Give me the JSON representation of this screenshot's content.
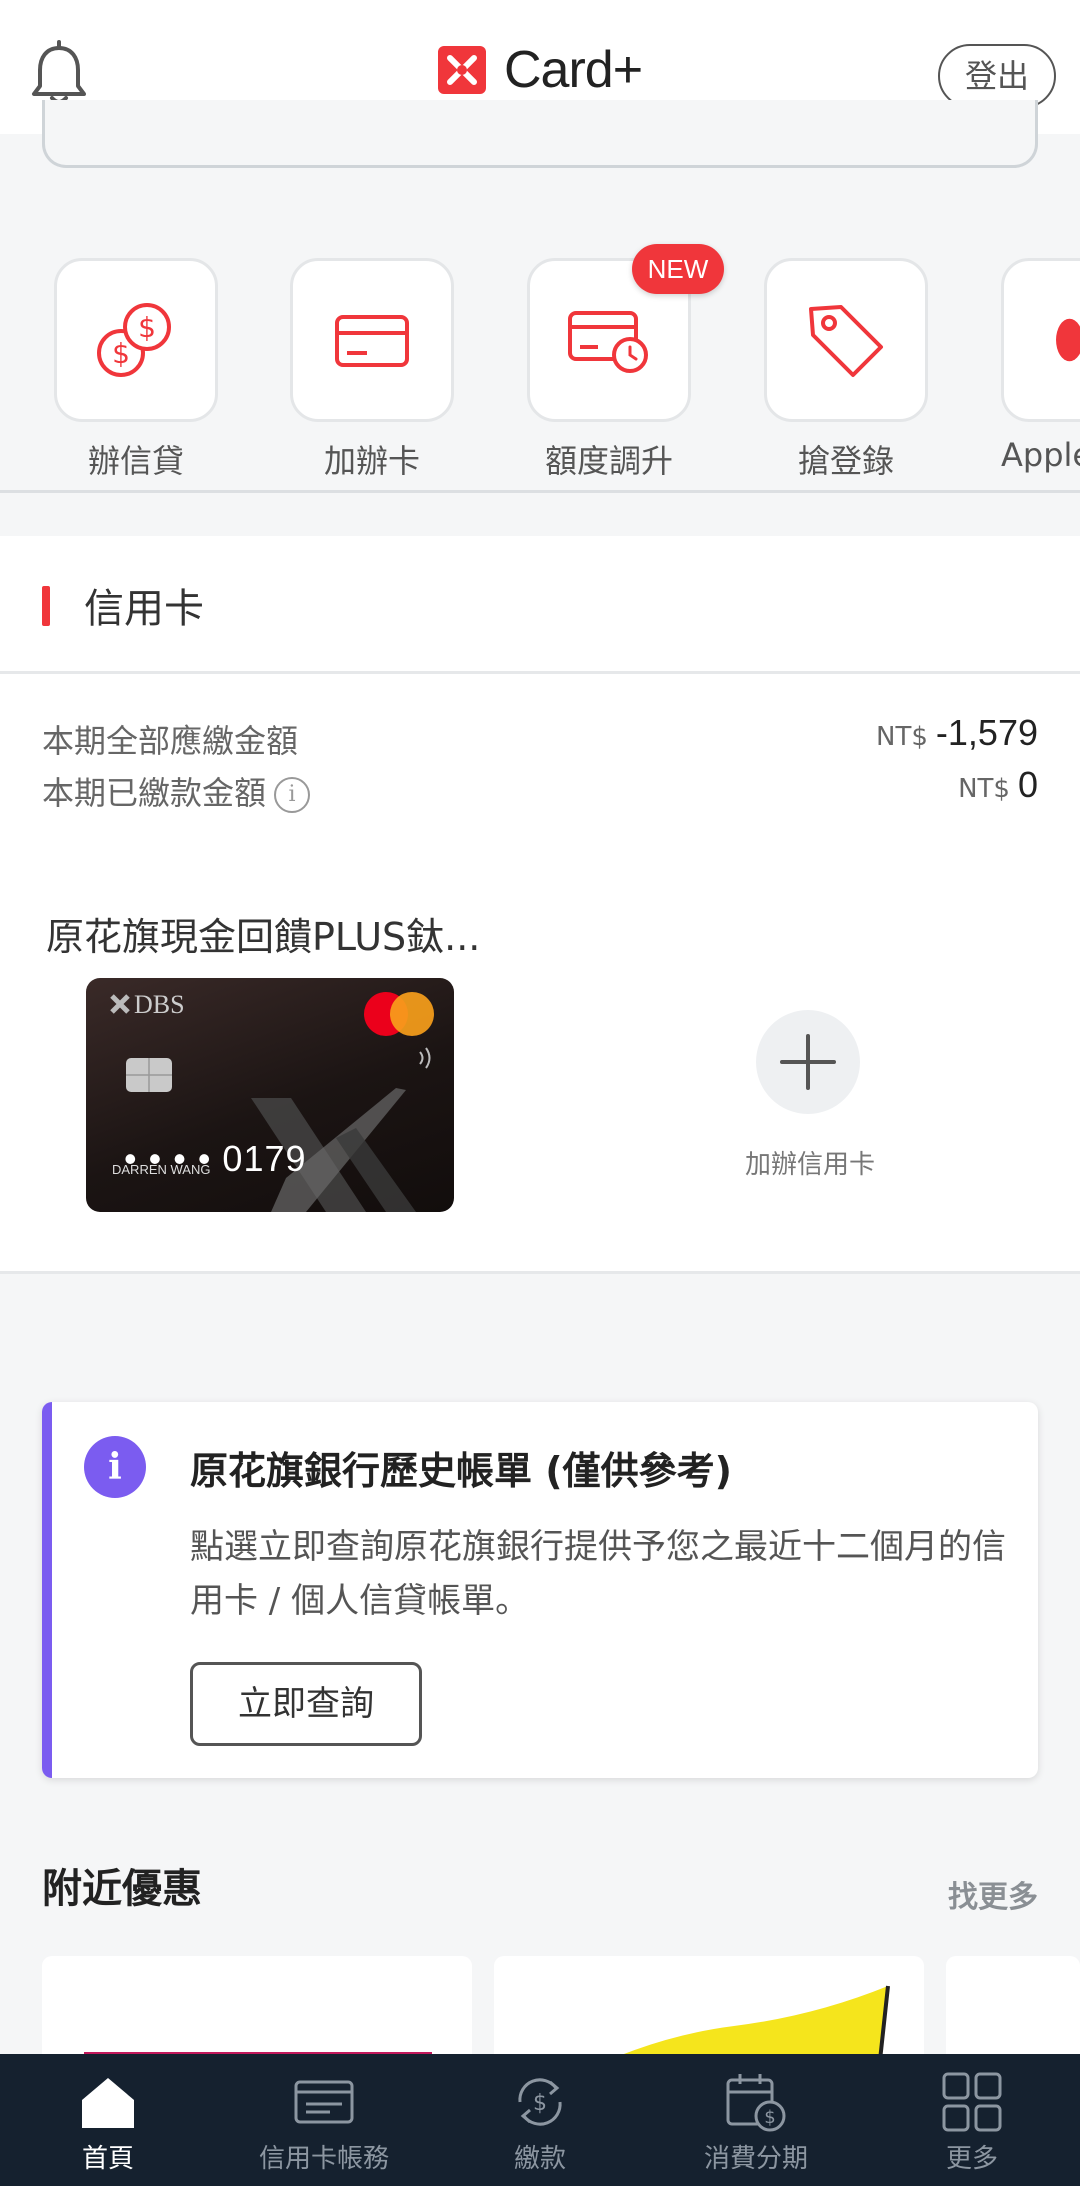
{
  "header": {
    "brand": "Card+",
    "logout_label": "登出"
  },
  "quick_actions": [
    {
      "label": "辦信貸",
      "icon": "loan-coins-icon"
    },
    {
      "label": "加辦卡",
      "icon": "card-icon"
    },
    {
      "label": "額度調升",
      "icon": "card-clock-icon"
    },
    {
      "label": "搶登錄",
      "icon": "tag-icon"
    },
    {
      "label": "Apple",
      "icon": "apple-pay-icon"
    }
  ],
  "new_badge": "NEW",
  "credit_card": {
    "section_title": "信用卡",
    "total_due_label": "本期全部應繳金額",
    "total_due_currency": "NT$",
    "total_due_value": "-1,579",
    "paid_label": "本期已繳款金額",
    "paid_currency": "NT$",
    "paid_value": "0",
    "card_name": "原花旗現金回饋PLUS鈦...",
    "card_brand": "DBS",
    "card_number": "• • • • 0179",
    "card_holder": "DARREN WANG",
    "add_card_label": "加辦信用卡"
  },
  "history_notice": {
    "title": "原花旗銀行歷史帳單 (僅供參考)",
    "body": "點選立即查詢原花旗銀行提供予您之最近十二個月的信用卡 / 個人信貸帳單。",
    "button_label": "立即查詢"
  },
  "nearby": {
    "title": "附近優惠",
    "more_label": "找更多"
  },
  "bottom_nav": [
    {
      "label": "首頁",
      "icon": "home-icon",
      "active": true
    },
    {
      "label": "信用卡帳務",
      "icon": "statement-icon",
      "active": false
    },
    {
      "label": "繳款",
      "icon": "payment-icon",
      "active": false
    },
    {
      "label": "消費分期",
      "icon": "installment-icon",
      "active": false
    },
    {
      "label": "更多",
      "icon": "grid-icon",
      "active": false
    }
  ],
  "colors": {
    "accent_red": "#f0363b",
    "notice_purple": "#7b5cf0",
    "nav_bg": "#15212f"
  }
}
